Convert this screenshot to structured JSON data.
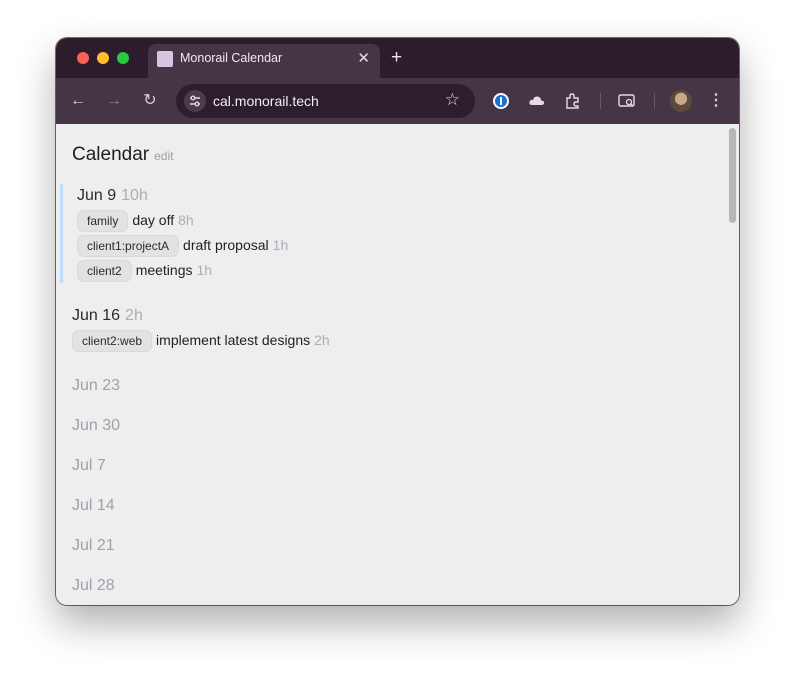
{
  "browser": {
    "tab_title": "Monorail Calendar",
    "new_tab_label": "+",
    "url": "cal.monorail.tech"
  },
  "page": {
    "title": "Calendar",
    "edit_label": "edit"
  },
  "weeks": [
    {
      "label": "Jun 9",
      "hours": "10h",
      "entries": [
        {
          "tag": "family",
          "text": "day off",
          "hours": "8h"
        },
        {
          "tag": "client1:projectA",
          "text": "draft proposal",
          "hours": "1h"
        },
        {
          "tag": "client2",
          "text": "meetings",
          "hours": "1h"
        }
      ]
    },
    {
      "label": "Jun 16",
      "hours": "2h",
      "entries": [
        {
          "tag": "client2:web",
          "text": "implement latest designs",
          "hours": "2h"
        }
      ]
    },
    {
      "label": "Jun 23"
    },
    {
      "label": "Jun 30"
    },
    {
      "label": "Jul 7"
    },
    {
      "label": "Jul 14"
    },
    {
      "label": "Jul 21"
    },
    {
      "label": "Jul 28"
    }
  ],
  "colors": {
    "accent_bar": "#bfdbfc",
    "muted_text": "#a7afb9",
    "titlebar": "#2d1d2c",
    "toolbar": "#463545"
  }
}
